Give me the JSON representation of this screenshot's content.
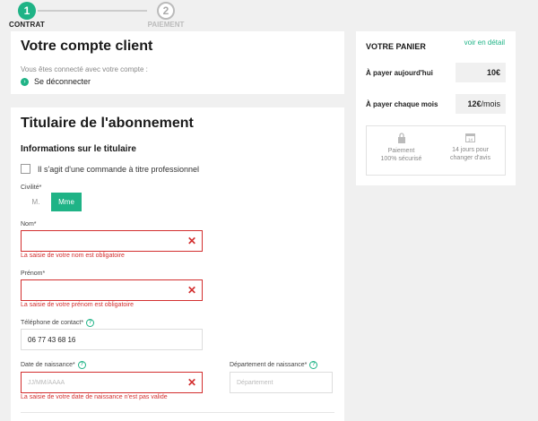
{
  "stepper": {
    "step1": {
      "num": "1",
      "label": "CONTRAT"
    },
    "step2": {
      "num": "2",
      "label": "PAIEMENT"
    }
  },
  "account": {
    "title": "Votre compte client",
    "connected_text": "Vous êtes connecté avec votre compte :",
    "logout_label": "Se déconnecter"
  },
  "holder": {
    "title": "Titulaire de l'abonnement",
    "subtitle": "Informations sur le titulaire",
    "pro_checkbox_label": "Il s'agit d'une commande à titre professionnel",
    "civility": {
      "label": "Civilité*",
      "options": [
        "M.",
        "Mme"
      ],
      "selected": "Mme"
    },
    "nom": {
      "label": "Nom*",
      "value": "",
      "error": "La saisie de votre nom est obligatoire"
    },
    "prenom": {
      "label": "Prénom*",
      "value": "",
      "error": "La saisie de votre prénom est obligatoire"
    },
    "phone": {
      "label": "Téléphone de contact*",
      "value": "06 77 43 68 16"
    },
    "birthdate": {
      "label": "Date de naissance*",
      "placeholder": "JJ/MM/AAAA",
      "error": "La saisie de votre date de naissance n'est pas valide"
    },
    "birth_dept": {
      "label": "Département de naissance*",
      "placeholder": "Département"
    }
  },
  "cart": {
    "title": "VOTRE PANIER",
    "detail_link": "voir en détail",
    "today": {
      "label": "À payer aujourd'hui",
      "amount": "10€"
    },
    "monthly": {
      "label": "À payer chaque mois",
      "amount": "12€",
      "unit": "/mois"
    },
    "info": [
      {
        "icon": "lock-icon",
        "text1": "Paiement",
        "text2": "100% sécurisé"
      },
      {
        "icon": "calendar-icon",
        "text1": "14 jours pour",
        "text2": "changer d'avis"
      }
    ]
  },
  "colors": {
    "accent": "#1fb386",
    "error": "#d32f2f"
  }
}
